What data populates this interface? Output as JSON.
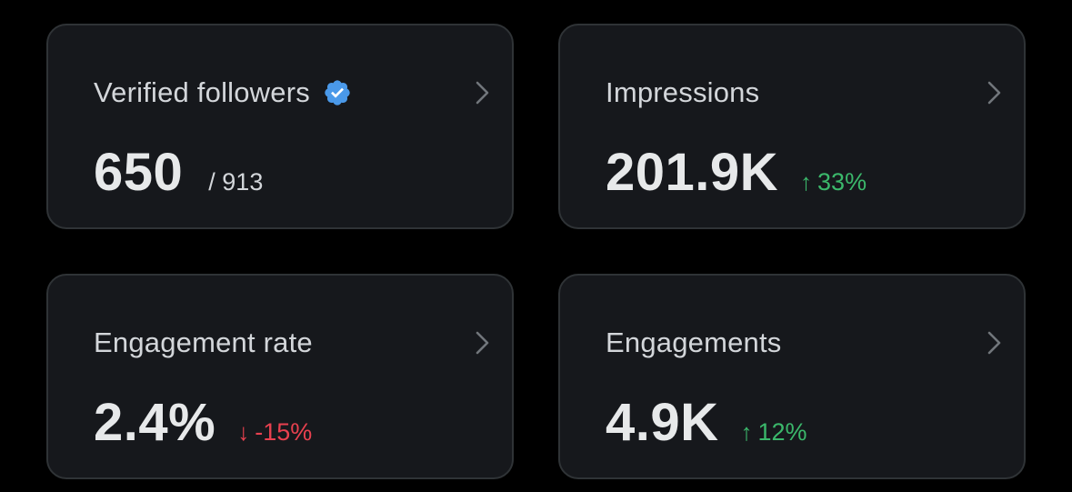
{
  "colors": {
    "background": "#000000",
    "card_background": "#16181c",
    "card_border": "#2f3336",
    "up": "#3bb86b",
    "down": "#e8414f",
    "verified": "#4a99e9"
  },
  "cards": [
    {
      "label": "Verified followers",
      "value": "650",
      "total": "/ 913",
      "has_verified_icon": true,
      "icon": "chevron-right-icon"
    },
    {
      "label": "Impressions",
      "value": "201.9K",
      "delta": "33%",
      "delta_direction": "up",
      "delta_arrow": "↑",
      "icon": "chevron-right-icon"
    },
    {
      "label": "Engagement rate",
      "value": "2.4%",
      "delta": "-15%",
      "delta_direction": "down",
      "delta_arrow": "↓",
      "icon": "chevron-right-icon"
    },
    {
      "label": "Engagements",
      "value": "4.9K",
      "delta": "12%",
      "delta_direction": "up",
      "delta_arrow": "↑",
      "icon": "chevron-right-icon"
    }
  ]
}
